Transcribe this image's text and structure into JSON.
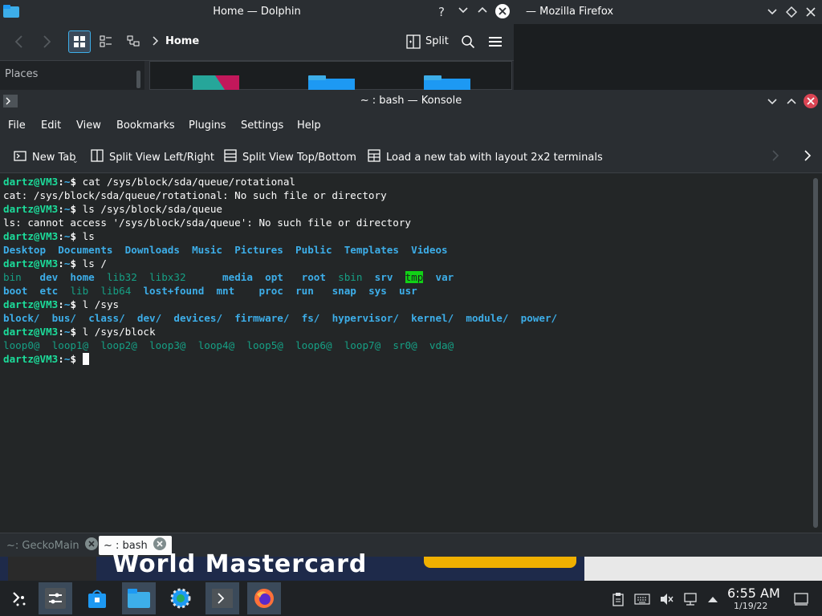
{
  "dolphin": {
    "title": "Home — Dolphin",
    "breadcrumb": "Home",
    "split_label": "Split",
    "places_label": "Places"
  },
  "firefox": {
    "title": "— Mozilla Firefox"
  },
  "konsole": {
    "title": "~ : bash — Konsole",
    "menu": [
      "File",
      "Edit",
      "View",
      "Bookmarks",
      "Plugins",
      "Settings",
      "Help"
    ],
    "toolbar": {
      "new_tab": "New Tab",
      "split_lr": "Split View Left/Right",
      "split_tb": "Split View Top/Bottom",
      "layout_2x2": "Load a new tab with layout 2x2 terminals"
    },
    "tabs": [
      {
        "label": "~: GeckoMain"
      },
      {
        "label": "~ : bash"
      }
    ]
  },
  "terminal": {
    "user_host": "dartz@VM3",
    "cwd": "~",
    "lines": {
      "cmd1": "cat /sys/block/sda/queue/rotational",
      "out1": "cat: /sys/block/sda/queue/rotational: No such file or directory",
      "cmd2": "ls /sys/block/sda/queue",
      "out2": "ls: cannot access '/sys/block/sda/queue': No such file or directory",
      "cmd3": "ls",
      "out3": [
        "Desktop",
        "Documents",
        "Downloads",
        "Music",
        "Pictures",
        "Public",
        "Templates",
        "Videos"
      ],
      "cmd4": "ls /",
      "out4a": [
        "bin",
        "dev",
        "home",
        "lib32",
        "libx32",
        "media",
        "opt",
        "root",
        "sbin",
        "srv",
        "tmp",
        "var"
      ],
      "out4b": [
        "boot",
        "etc",
        "lib",
        "lib64",
        "lost+found",
        "mnt",
        "proc",
        "run",
        "snap",
        "sys",
        "usr"
      ],
      "cmd5": "l /sys",
      "out5": [
        "block/",
        "bus/",
        "class/",
        "dev/",
        "devices/",
        "firmware/",
        "fs/",
        "hypervisor/",
        "kernel/",
        "module/",
        "power/"
      ],
      "cmd6": "l /sys/block",
      "out6": [
        "loop0@",
        "loop1@",
        "loop2@",
        "loop3@",
        "loop4@",
        "loop5@",
        "loop6@",
        "loop7@",
        "sr0@",
        "vda@"
      ]
    }
  },
  "wallpaper": {
    "text": "World Mastercard"
  },
  "panel": {
    "time": "6:55 AM",
    "date": "1/19/22"
  },
  "colors": {
    "prompt_green": "#1cdc9a",
    "dir_blue": "#3daee9",
    "link_teal": "#16a085",
    "tmp_highlight": "#11d116",
    "close_red": "#da4453"
  }
}
